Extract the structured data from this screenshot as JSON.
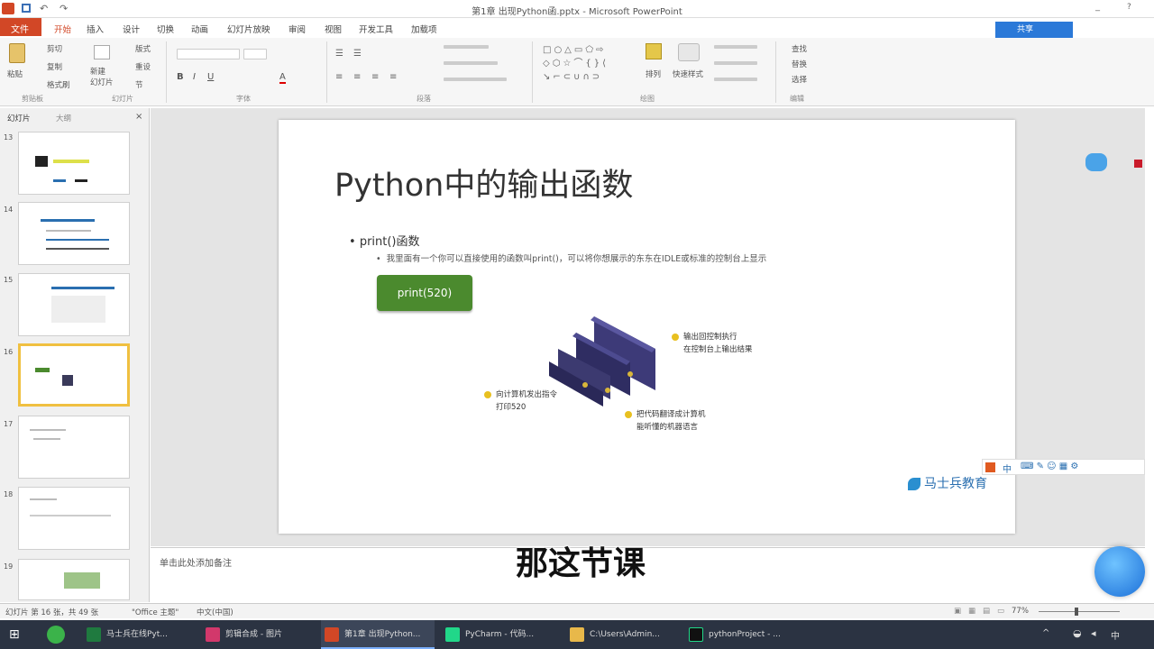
{
  "window": {
    "title": "第1章 出现Python函.pptx - Microsoft PowerPoint"
  },
  "ribbon": {
    "file_label": "文件",
    "tabs": [
      "开始",
      "插入",
      "设计",
      "切换",
      "动画",
      "幻灯片放映",
      "审阅",
      "视图",
      "开发工具",
      "加载项"
    ],
    "paste_label": "粘贴",
    "cut_label": "剪切",
    "copy_label": "复制",
    "format_painter_label": "格式刷",
    "new_slide_label": "新建\n幻灯片",
    "layout_label": "版式",
    "reset_label": "重设",
    "section_label": "节",
    "arrange_label": "排列",
    "quick_styles_label": "快速样式",
    "find_label": "查找",
    "replace_label": "替换",
    "select_label": "选择",
    "groups": [
      "剪贴板",
      "幻灯片",
      "字体",
      "段落",
      "绘图",
      "编辑"
    ]
  },
  "thumbs": {
    "tabs": [
      "幻灯片",
      "大纲"
    ],
    "numbers": [
      "13",
      "14",
      "15",
      "16",
      "17",
      "18",
      "19"
    ]
  },
  "slide": {
    "title": "Python中的输出函数",
    "bullet1": "print()函数",
    "bullet2": "我里面有一个你可以直接使用的函数叫print()，可以将你想展示的东东在IDLE或标准的控制台上显示",
    "button": "print(520)",
    "callout_top_1": "输出回控制执行",
    "callout_top_2": "在控制台上输出结果",
    "callout_left_1": "向计算机发出指令",
    "callout_left_2": "打印520",
    "callout_bottom_1": "把代码翻译成计算机",
    "callout_bottom_2": "能听懂的机器语言",
    "logo": "马士兵教育"
  },
  "notes": {
    "placeholder": "单击此处添加备注"
  },
  "subtitle": "那这节课",
  "status": {
    "slide_info": "幻灯片 第 16 张，共 49 张",
    "theme": "\"Office 主题\"",
    "language": "中文(中国)",
    "zoom": "77%"
  },
  "taskbar": {
    "items": [
      "马士兵在线Pyt...",
      "剪辑合成 - 图片",
      "第1章 出现Python...",
      "PyCharm - 代码...",
      "C:\\Users\\Admin...",
      "pythonProject - ..."
    ],
    "ime": "中"
  },
  "share_label": "共享"
}
